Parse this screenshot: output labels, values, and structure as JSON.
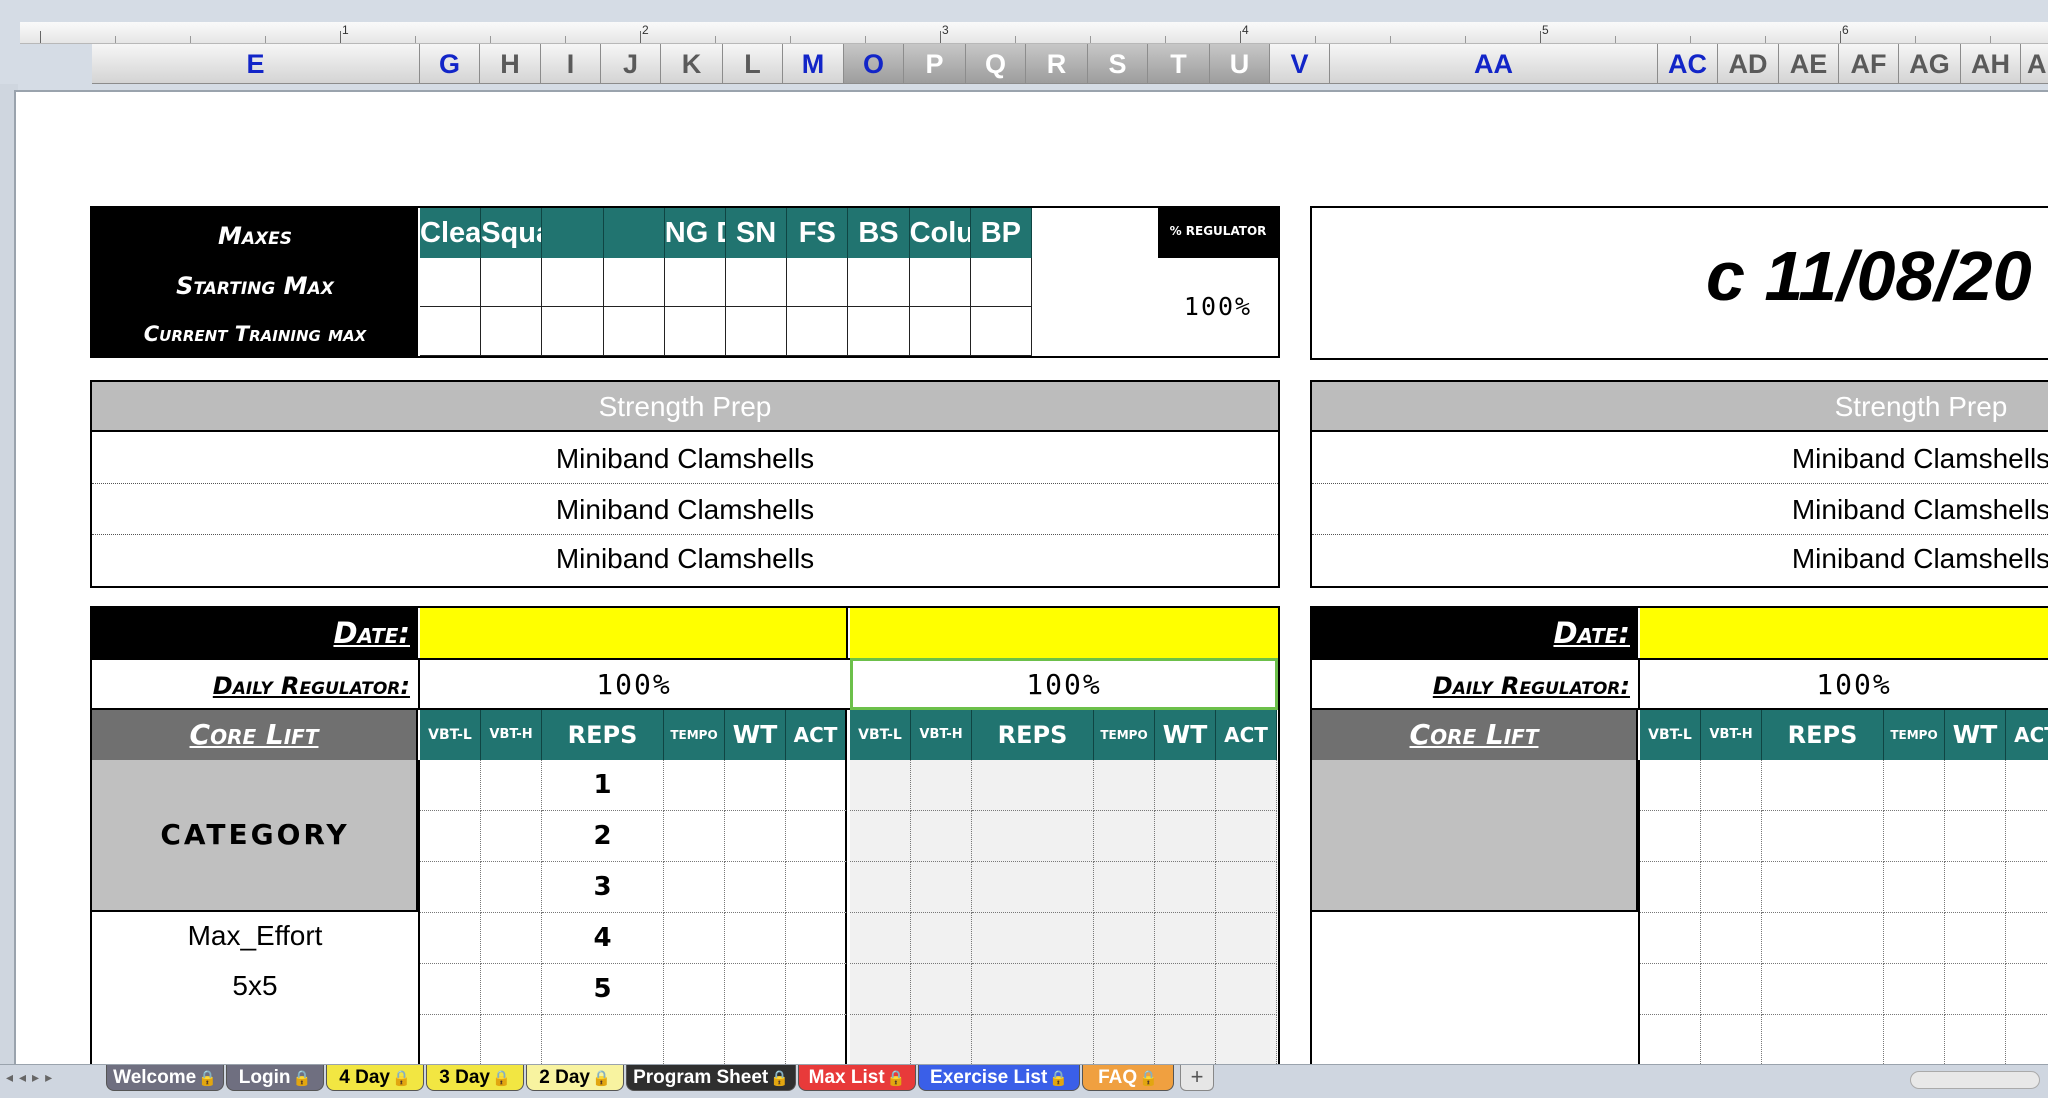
{
  "ruler": {
    "numbers": [
      "1",
      "2",
      "3",
      "4",
      "5",
      "6"
    ]
  },
  "columns": [
    "E",
    "G",
    "H",
    "I",
    "J",
    "K",
    "L",
    "M",
    "O",
    "P",
    "Q",
    "R",
    "S",
    "T",
    "U",
    "V",
    "AA",
    "AC",
    "AD",
    "AE",
    "AF",
    "AG",
    "AH",
    "AI"
  ],
  "maxes": {
    "label_maxes": "Maxes",
    "label_starting": "Starting Max",
    "label_current": "Current Training max",
    "lifts": [
      "Clean",
      "Squat",
      "",
      "",
      "NG DB",
      "SN",
      "FS",
      "BS",
      "Column",
      "BP"
    ],
    "regulator_label": "% REGULATOR",
    "regulator_value": "100%"
  },
  "date_banner": "c 11/08/20",
  "prep": {
    "header": "Strength Prep",
    "rows": [
      "Miniband Clamshells",
      "Miniband Clamshells",
      "Miniband Clamshells"
    ]
  },
  "session": {
    "date_label": "Date:",
    "regulator_label": "Daily Regulator:",
    "regulator_value": "100%",
    "core_lift_label": "Core Lift",
    "category": "CATEGORY",
    "subheaders": [
      "VBT-L",
      "VBT-H",
      "REPS",
      "TEMPO",
      "WT",
      "ACT"
    ],
    "reps": [
      "1",
      "2",
      "3",
      "4",
      "5"
    ],
    "lift_name": "Max_Effort",
    "scheme": "5x5"
  },
  "tabs": [
    {
      "label": "Welcome",
      "color": "#6f6f80"
    },
    {
      "label": "Login",
      "color": "#6f6f80"
    },
    {
      "label": "4 Day",
      "color": "#f2e642"
    },
    {
      "label": "3 Day",
      "color": "#f2e642"
    },
    {
      "label": "2 Day",
      "color": "#f8f3a0"
    },
    {
      "label": "Program Sheet",
      "color": "#2f2f2f"
    },
    {
      "label": "Max List",
      "color": "#e83a3a"
    },
    {
      "label": "Exercise List",
      "color": "#3a5fe8"
    },
    {
      "label": "FAQ",
      "color": "#f0a040"
    }
  ]
}
